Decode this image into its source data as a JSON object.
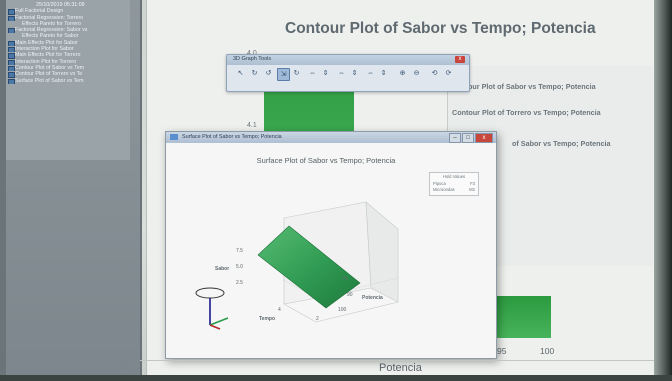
{
  "project_tree": {
    "header": "25/10/2019 05:31:09",
    "items": [
      {
        "label": "Full Factorial Design",
        "indent": false
      },
      {
        "label": "Factorial Regression: Torrero",
        "indent": false
      },
      {
        "label": "Effects Pareto for Torrero",
        "indent": true
      },
      {
        "label": "Factorial Regression: Sabor vs",
        "indent": false
      },
      {
        "label": "Effects Pareto for Sabor",
        "indent": true
      },
      {
        "label": "Main Effects Plot for Sabor",
        "indent": false
      },
      {
        "label": "Interaction Plot for Sabor",
        "indent": false
      },
      {
        "label": "Main Effects Plot for Torrero",
        "indent": false
      },
      {
        "label": "Interaction Plot for Torrero",
        "indent": false
      },
      {
        "label": "Contour Plot of Sabor vs Tem",
        "indent": false
      },
      {
        "label": "Contour Plot of Torrero vs Te",
        "indent": false
      },
      {
        "label": "Surface Plot of Sabor vs Tem",
        "indent": false
      }
    ]
  },
  "main_graph": {
    "title": "Contour Plot of Sabor vs Tempo; Potencia",
    "legend_lines": [
      "our Plot of Sabor vs Tempo; Potencia",
      "Contour Plot of Torrero vs Tempo; Potencia",
      "of Sabor vs Tempo; Potencia"
    ],
    "y_ticks": [
      "4.0",
      "4.1"
    ],
    "x_ticks": [
      "95",
      "100"
    ],
    "x_axis_label": "Potencia"
  },
  "toolbar": {
    "title": "3D Graph Tools",
    "close": "x",
    "tools": [
      "↖",
      "↻",
      "↺",
      "⇲",
      "↻",
      "⇔",
      "⇕",
      "⇔",
      "⇕",
      "⇔",
      "⇕",
      "⊕",
      "⊖",
      "⟲",
      "⟳"
    ]
  },
  "surface_window": {
    "title_bar": "Surface Plot of Sabor vs Tempo; Potencia",
    "plot_title": "Surface Plot of Sabor vs Tempo; Potencia",
    "hold_values": {
      "title": "Hold Values",
      "rows": [
        {
          "name": "Pipoca",
          "value": "F3"
        },
        {
          "name": "Microondas",
          "value": "M2"
        }
      ]
    },
    "axis_sabor": "Sabor",
    "axis_tempo": "Tempo",
    "axis_potencia": "Potencia",
    "z_ticks": [
      "7.5",
      "5.0",
      "2.5"
    ],
    "tempo_ticks": [
      "4",
      "2"
    ],
    "potencia_ticks": [
      "75",
      "90",
      "100"
    ],
    "buttons": {
      "min": "–",
      "max": "□",
      "close": "x"
    }
  },
  "colors": {
    "surface_green": "#2f9a52",
    "accent_blue": "#4c78a8",
    "close_red": "#c8473c"
  }
}
